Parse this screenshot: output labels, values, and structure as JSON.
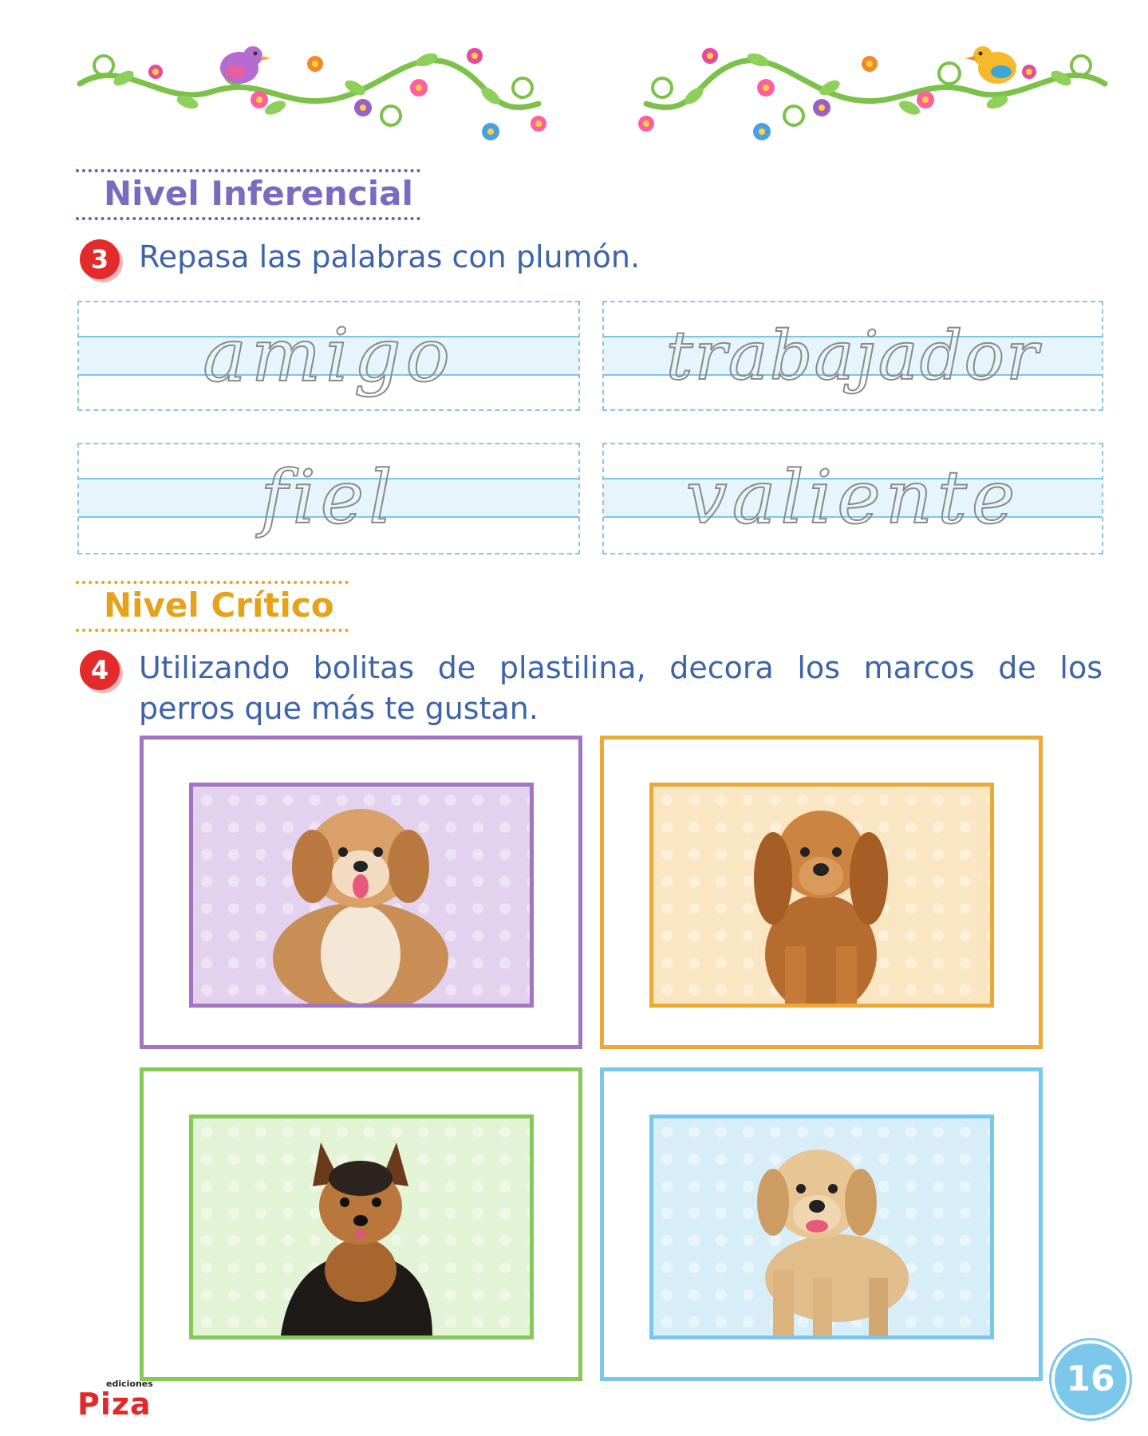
{
  "colors": {
    "purple": "#a274c2",
    "orange": "#eaaa35",
    "green": "#87c85a",
    "blue": "#79c8ec",
    "text_blue": "#3d63a8",
    "badge_red": "#e32b2b"
  },
  "header": {
    "decoration": "floral-garland-with-birds"
  },
  "section_inferencial": {
    "title": "Nivel Inferencial",
    "exercise": {
      "number": "3",
      "instruction": "Repasa las palabras con plumón.",
      "words": [
        "amigo",
        "trabajador",
        "fiel",
        "valiente"
      ]
    }
  },
  "section_critico": {
    "title": "Nivel Crítico",
    "exercise": {
      "number": "4",
      "instruction_line1": "Utilizando bolitas de plastilina, decora los marcos de los",
      "instruction_line2": "perros que más te gustan.",
      "frames": [
        {
          "color": "purple",
          "dog": "havanese-puppy"
        },
        {
          "color": "orange",
          "dog": "cocker-spaniel-puppy"
        },
        {
          "color": "green",
          "dog": "yorkshire-terrier-puppy"
        },
        {
          "color": "blue",
          "dog": "labrador-puppy"
        }
      ]
    }
  },
  "footer": {
    "brand_small": "ediciones",
    "brand": "Piza",
    "page_number": "16"
  }
}
